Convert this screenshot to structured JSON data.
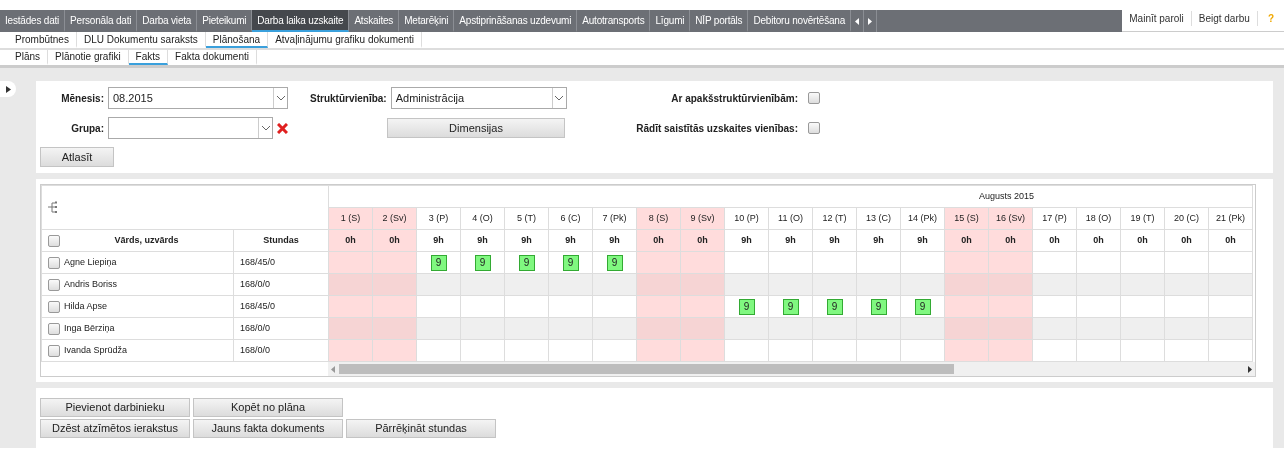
{
  "main_nav": {
    "tabs": [
      {
        "label": "Iestādes dati",
        "selected": false
      },
      {
        "label": "Personāla dati",
        "selected": false
      },
      {
        "label": "Darba vieta",
        "selected": false
      },
      {
        "label": "Pieteikumi",
        "selected": false
      },
      {
        "label": "Darba laika uzskaite",
        "selected": true
      },
      {
        "label": "Atskaites",
        "selected": false
      },
      {
        "label": "Metarēķini",
        "selected": false
      },
      {
        "label": "Apstiprināšanas uzdevumi",
        "selected": false
      },
      {
        "label": "Autotransports",
        "selected": false
      },
      {
        "label": "Līgumi",
        "selected": false
      },
      {
        "label": "NĪP portāls",
        "selected": false
      },
      {
        "label": "Debitoru novērtēšana",
        "selected": false
      }
    ],
    "user_links": [
      "Mainīt paroli",
      "Beigt darbu"
    ],
    "help": "?"
  },
  "sub_tabs": [
    {
      "label": "Prombūtnes",
      "selected": false
    },
    {
      "label": "DLU Dokumentu saraksts",
      "selected": false
    },
    {
      "label": "Plānošana",
      "selected": true
    },
    {
      "label": "Atvaļinājumu grafiku dokumenti",
      "selected": false
    }
  ],
  "sub_sub_tabs": [
    {
      "label": "Plāns",
      "selected": false
    },
    {
      "label": "Plānotie grafiki",
      "selected": false
    },
    {
      "label": "Fakts",
      "selected": true
    },
    {
      "label": "Fakta dokumenti",
      "selected": false
    }
  ],
  "filters": {
    "month": {
      "label": "Mēnesis:",
      "value": "08.2015"
    },
    "group": {
      "label": "Grupa:"
    },
    "structure": {
      "label": "Struktūrvienība:",
      "value": "Administrācija"
    },
    "dimensions_button": "Dimensijas",
    "options": [
      {
        "label": "Ar apakšstruktūrvienībām:",
        "checked": false
      },
      {
        "label": "Rādīt saistītās uzskaites vienības:",
        "checked": false
      }
    ],
    "select_button": "Atlasīt"
  },
  "grid": {
    "month": "Augusts 2015",
    "name_header": "Vārds, uzvārds",
    "hours_header": "Stundas",
    "select_all_checked": false,
    "days": [
      {
        "label": "1 (S)",
        "hours": "0h",
        "weekend": true
      },
      {
        "label": "2 (Sv)",
        "hours": "0h",
        "weekend": true
      },
      {
        "label": "3 (P)",
        "hours": "9h",
        "weekend": false
      },
      {
        "label": "4 (O)",
        "hours": "9h",
        "weekend": false
      },
      {
        "label": "5 (T)",
        "hours": "9h",
        "weekend": false
      },
      {
        "label": "6 (C)",
        "hours": "9h",
        "weekend": false
      },
      {
        "label": "7 (Pk)",
        "hours": "9h",
        "weekend": false
      },
      {
        "label": "8 (S)",
        "hours": "0h",
        "weekend": true
      },
      {
        "label": "9 (Sv)",
        "hours": "0h",
        "weekend": true
      },
      {
        "label": "10 (P)",
        "hours": "9h",
        "weekend": false
      },
      {
        "label": "11 (O)",
        "hours": "9h",
        "weekend": false
      },
      {
        "label": "12 (T)",
        "hours": "9h",
        "weekend": false
      },
      {
        "label": "13 (C)",
        "hours": "9h",
        "weekend": false
      },
      {
        "label": "14 (Pk)",
        "hours": "9h",
        "weekend": false
      },
      {
        "label": "15 (S)",
        "hours": "0h",
        "weekend": true
      },
      {
        "label": "16 (Sv)",
        "hours": "0h",
        "weekend": true
      },
      {
        "label": "17 (P)",
        "hours": "0h",
        "weekend": false
      },
      {
        "label": "18 (O)",
        "hours": "0h",
        "weekend": false
      },
      {
        "label": "19 (T)",
        "hours": "0h",
        "weekend": false
      },
      {
        "label": "20 (C)",
        "hours": "0h",
        "weekend": false
      },
      {
        "label": "21 (Pk)",
        "hours": "0h",
        "weekend": false
      }
    ],
    "rows": [
      {
        "name": "Agne Liepiņa",
        "hours": "168/45/0",
        "checked": false,
        "cells": [
          null,
          null,
          "9",
          "9",
          "9",
          "9",
          "9",
          null,
          null,
          null,
          null,
          null,
          null,
          null,
          null,
          null,
          null,
          null,
          null,
          null,
          null
        ]
      },
      {
        "name": "Andris Boriss",
        "hours": "168/0/0",
        "checked": false,
        "cells": [
          null,
          null,
          null,
          null,
          null,
          null,
          null,
          null,
          null,
          null,
          null,
          null,
          null,
          null,
          null,
          null,
          null,
          null,
          null,
          null,
          null
        ]
      },
      {
        "name": "Hilda Apse",
        "hours": "168/45/0",
        "checked": false,
        "cells": [
          null,
          null,
          null,
          null,
          null,
          null,
          null,
          null,
          null,
          "9",
          "9",
          "9",
          "9",
          "9",
          null,
          null,
          null,
          null,
          null,
          null,
          null
        ]
      },
      {
        "name": "Inga Bērziņa",
        "hours": "168/0/0",
        "checked": false,
        "cells": [
          null,
          null,
          null,
          null,
          null,
          null,
          null,
          null,
          null,
          null,
          null,
          null,
          null,
          null,
          null,
          null,
          null,
          null,
          null,
          null,
          null
        ]
      },
      {
        "name": "Ivanda Sprūdža",
        "hours": "168/0/0",
        "checked": false,
        "cells": [
          null,
          null,
          null,
          null,
          null,
          null,
          null,
          null,
          null,
          null,
          null,
          null,
          null,
          null,
          null,
          null,
          null,
          null,
          null,
          null,
          null
        ]
      }
    ]
  },
  "actions": [
    [
      "Pievienot darbinieku",
      "Kopēt no plāna"
    ],
    [
      "Dzēst atzīmētos ierakstus",
      "Jauns fakta dokuments",
      "Pārrēķināt stundas"
    ]
  ]
}
